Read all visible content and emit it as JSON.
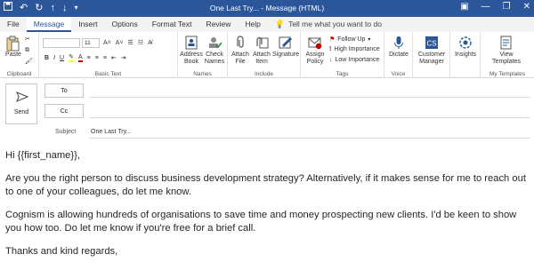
{
  "window": {
    "title": "One Last Try...  -  Message (HTML)"
  },
  "tabs": [
    {
      "label": "File"
    },
    {
      "label": "Message"
    },
    {
      "label": "Insert"
    },
    {
      "label": "Options"
    },
    {
      "label": "Format Text"
    },
    {
      "label": "Review"
    },
    {
      "label": "Help"
    }
  ],
  "tell_me": {
    "placeholder": "Tell me what you want to do"
  },
  "ribbon": {
    "clipboard": {
      "label": "Clipboard",
      "paste": "Paste"
    },
    "basic_text": {
      "label": "Basic Text",
      "font_size": "11"
    },
    "names": {
      "label": "Names",
      "address_book": "Address Book",
      "check_names": "Check Names"
    },
    "include": {
      "label": "Include",
      "attach_file": "Attach File",
      "attach_item": "Attach Item",
      "signature": "Signature"
    },
    "tags": {
      "label": "Tags",
      "assign_policy": "Assign Policy",
      "follow_up": "Follow Up",
      "high_importance": "High Importance",
      "low_importance": "Low Importance"
    },
    "voice": {
      "label": "Voice",
      "dictate": "Dictate"
    },
    "crm": {
      "customer_manager": "Customer Manager"
    },
    "insights": {
      "label": "Insights"
    },
    "my_templates": {
      "label": "My Templates",
      "view_templates": "View Templates"
    }
  },
  "compose": {
    "send": "Send",
    "to": "To",
    "cc": "Cc",
    "subject_label": "Subject",
    "subject_value": "One Last Try..."
  },
  "body": {
    "greeting": "Hi {{first_name}},",
    "p1": "Are you the right person to discuss business development strategy? Alternatively, if it makes sense for me to reach out to one of your colleagues, do let me know.",
    "p2": "Cognism is allowing hundreds of organisations to save time and money prospecting new clients. I'd be keen to show you how too. Do let me know if you're free for a brief call.",
    "closing": "Thanks and kind regards,"
  },
  "colors": {
    "accent": "#2b579a",
    "high_importance": "#c00000",
    "low_importance": "#2b579a"
  }
}
